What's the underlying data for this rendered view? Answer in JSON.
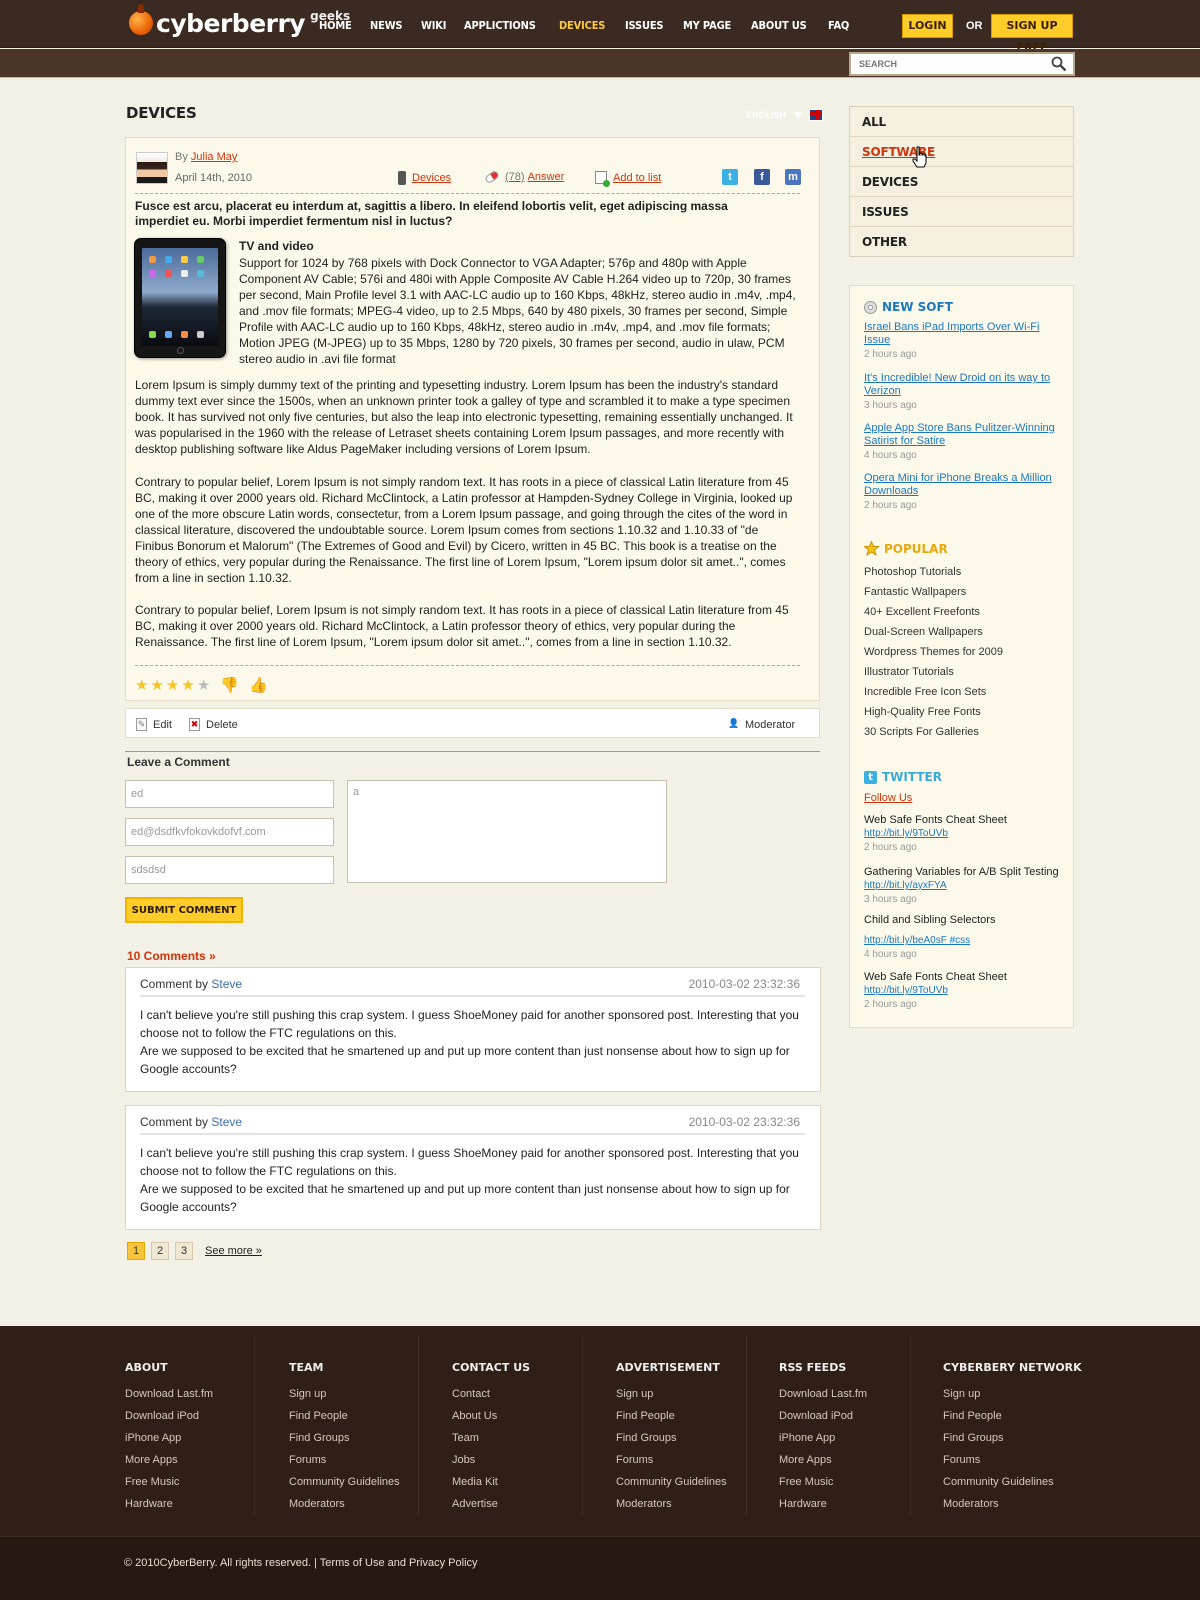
{
  "brand": {
    "name": "cyberberry",
    "tagline": "geeks"
  },
  "nav": [
    "HOME",
    "NEWS",
    "WIKI",
    "APPLICTIONS",
    "DEVICES",
    "ISSUES",
    "MY PAGE",
    "ABOUT US",
    "FAQ"
  ],
  "auth": {
    "login": "LOGIN",
    "or": "OR",
    "signup": "SIGN UP FREE"
  },
  "language": "ENGLISH",
  "search": {
    "placeholder": "SEARCH"
  },
  "page_title": "DEVICES",
  "article": {
    "by_prefix": "By",
    "author": "Julia May",
    "date": "April 14th, 2010",
    "category": "Devices",
    "answer_count": "(78)",
    "answer_label": "Answer",
    "add_to_list": "Add to list",
    "lead": "Fusce est arcu, placerat eu interdum at, sagittis a libero. In eleifend lobortis velit, eget adipiscing massa imperdiet eu. Morbi imperdiet fermentum nisl in luctus?",
    "tv_heading": "TV and video",
    "tv_body": "Support for 1024 by 768 pixels with Dock Connector to VGA Adapter; 576p and 480p with Apple Component AV Cable; 576i and 480i with Apple Composite AV Cable H.264 video up to 720p, 30 frames per second, Main Profile level 3.1 with AAC-LC audio up to 160 Kbps, 48kHz, stereo audio in .m4v, .mp4, and .mov file formats; MPEG-4 video, up to 2.5 Mbps, 640 by 480 pixels, 30 frames per second, Simple Profile with AAC-LC audio up to 160 Kbps, 48kHz, stereo audio in .m4v, .mp4, and .mov file formats; Motion JPEG (M-JPEG) up to 35 Mbps, 1280 by 720 pixels, 30 frames per second, audio in ulaw, PCM stereo audio in .avi file format",
    "para1": "Lorem Ipsum is simply dummy text of the printing and typesetting industry. Lorem Ipsum has been the industry's standard dummy text ever since the 1500s, when an unknown printer took a galley of type and scrambled it to make a type specimen book. It has survived not only five centuries, but also the leap into electronic typesetting, remaining essentially unchanged. It was popularised in the 1960 with the release of Letraset sheets containing Lorem Ipsum passages, and more recently with desktop publishing software like Aldus PageMaker including versions of Lorem Ipsum.",
    "para2": "Contrary to popular belief, Lorem Ipsum is not simply random text. It has roots in a piece of classical Latin literature from 45 BC, making it over 2000 years old. Richard McClintock, a Latin professor at Hampden-Sydney College in Virginia, looked up one of the more obscure Latin words, consectetur, from a Lorem Ipsum passage, and going through the cites of the word in classical literature, discovered the undoubtable source. Lorem Ipsum comes from sections 1.10.32 and 1.10.33 of \"de Finibus Bonorum et Malorum\" (The Extremes of Good and Evil) by Cicero, written in 45 BC. This book is a treatise on the theory of ethics, very popular during the Renaissance. The first line of Lorem Ipsum, \"Lorem ipsum dolor sit amet..\", comes from a line in section 1.10.32.",
    "para3": "Contrary to popular belief, Lorem Ipsum is not simply random text. It has roots in a piece of classical Latin literature from 45 BC, making it over 2000 years old. Richard McClintock, a Latin professor theory of ethics, very popular during the Renaissance. The first line of Lorem Ipsum, \"Lorem ipsum dolor sit amet..\", comes from a line in section 1.10.32.",
    "rating": 4,
    "rating_max": 5
  },
  "actions": {
    "edit": "Edit",
    "delete": "Delete",
    "moderator": "Moderator"
  },
  "comment_form": {
    "heading": "Leave a Comment",
    "name": "ed",
    "email": "ed@dsdfkvfokovkdofvf.com",
    "website": "sdsdsd",
    "message": "a",
    "submit": "SUBMIT COMMENT"
  },
  "comments_count": "10 Comments »",
  "comments": [
    {
      "by_prefix": "Comment by",
      "author": "Steve",
      "timestamp": "2010-03-02 23:32:36",
      "text1": "I can't believe you're still pushing this crap system. I guess ShoeMoney paid for another sponsored post. Interesting that you choose not to follow the FTC regulations on this.",
      "text2": "Are we supposed to be excited that he smartened up and put up more content than just nonsense about how to sign up for Google accounts?"
    },
    {
      "by_prefix": "Comment by",
      "author": "Steve",
      "timestamp": "2010-03-02 23:32:36",
      "text1": "I can't believe you're still pushing this crap system. I guess ShoeMoney paid for another sponsored post. Interesting that you choose not to follow the FTC regulations on this.",
      "text2": "Are we supposed to be excited that he smartened up and put up more content than just nonsense about how to sign up for Google accounts?"
    }
  ],
  "pagination": {
    "pages": [
      "1",
      "2",
      "3"
    ],
    "current": "1",
    "see_more": "See more »"
  },
  "categories": [
    "ALL",
    "SOFTWARE",
    "DEVICES",
    "ISSUES",
    "OTHER"
  ],
  "categories_active": "SOFTWARE",
  "new_soft": {
    "title": "NEW SOFT",
    "items": [
      {
        "title": "Israel Bans iPad Imports Over Wi-Fi Issue",
        "time": "2 hours ago"
      },
      {
        "title": "It's Incredible! New Droid on its way to Verizon",
        "time": "3 hours ago"
      },
      {
        "title": "Apple App Store Bans Pulitzer-Winning Satirist for Satire",
        "time": "4 hours ago"
      },
      {
        "title": "Opera Mini for iPhone Breaks a Million Downloads",
        "time": "2 hours ago"
      }
    ]
  },
  "popular": {
    "title": "POPULAR",
    "items": [
      "Photoshop Tutorials",
      "Fantastic Wallpapers",
      "40+ Excellent Freefonts",
      "Dual-Screen Wallpapers",
      "Wordpress Themes for 2009",
      "Illustrator Tutorials",
      "Incredible Free Icon Sets",
      "High-Quality Free Fonts",
      "30 Scripts For Galleries"
    ]
  },
  "twitter": {
    "title": "TWITTER",
    "follow": "Follow Us",
    "items": [
      {
        "text": "Web Safe Fonts Cheat Sheet",
        "link": "http://bit.ly/9ToUVb",
        "time": "2 hours ago"
      },
      {
        "text": "Gathering Variables for A/B Split Testing",
        "link": "http://bit.ly/ayxFYA",
        "time": "3 hours ago"
      },
      {
        "text": "Child and Sibling Selectors",
        "link": "http://bit.ly/beA0sF #css",
        "time": "4 hours ago"
      },
      {
        "text": "Web Safe Fonts Cheat Sheet",
        "link": "http://bit.ly/9ToUVb",
        "time": "2 hours ago"
      }
    ]
  },
  "footer": {
    "columns": [
      {
        "title": "ABOUT",
        "links": [
          "Download Last.fm",
          "Download iPod",
          "iPhone App",
          "More Apps",
          "Free Music",
          "Hardware"
        ]
      },
      {
        "title": "TEAM",
        "links": [
          "Sign up",
          "Find People",
          "Find Groups",
          "Forums",
          "Community Guidelines",
          "Moderators"
        ]
      },
      {
        "title": "CONTACT US",
        "links": [
          "Contact",
          "About Us",
          "Team",
          "Jobs",
          "Media Kit",
          "Advertise"
        ]
      },
      {
        "title": "ADVERTISEMENT",
        "links": [
          "Sign up",
          "Find People",
          "Find Groups",
          "Forums",
          "Community Guidelines",
          "Moderators"
        ]
      },
      {
        "title": "RSS FEEDS",
        "links": [
          "Download Last.fm",
          "Download iPod",
          "iPhone App",
          "More Apps",
          "Free Music",
          "Hardware"
        ]
      },
      {
        "title": "CYBERBERY NETWORK",
        "links": [
          "Sign up",
          "Find People",
          "Find Groups",
          "Forums",
          "Community Guidelines",
          "Moderators"
        ]
      }
    ],
    "copyright": "© 2010CyberBerry. All rights reserved. | Terms of Use and Privacy Policy"
  },
  "colors": {
    "accent": "#ffcc29",
    "link_red": "#d0340c",
    "link_blue": "#1a78c2",
    "header_bg": "#3a2a21",
    "footer_bg": "#2f1f17"
  }
}
